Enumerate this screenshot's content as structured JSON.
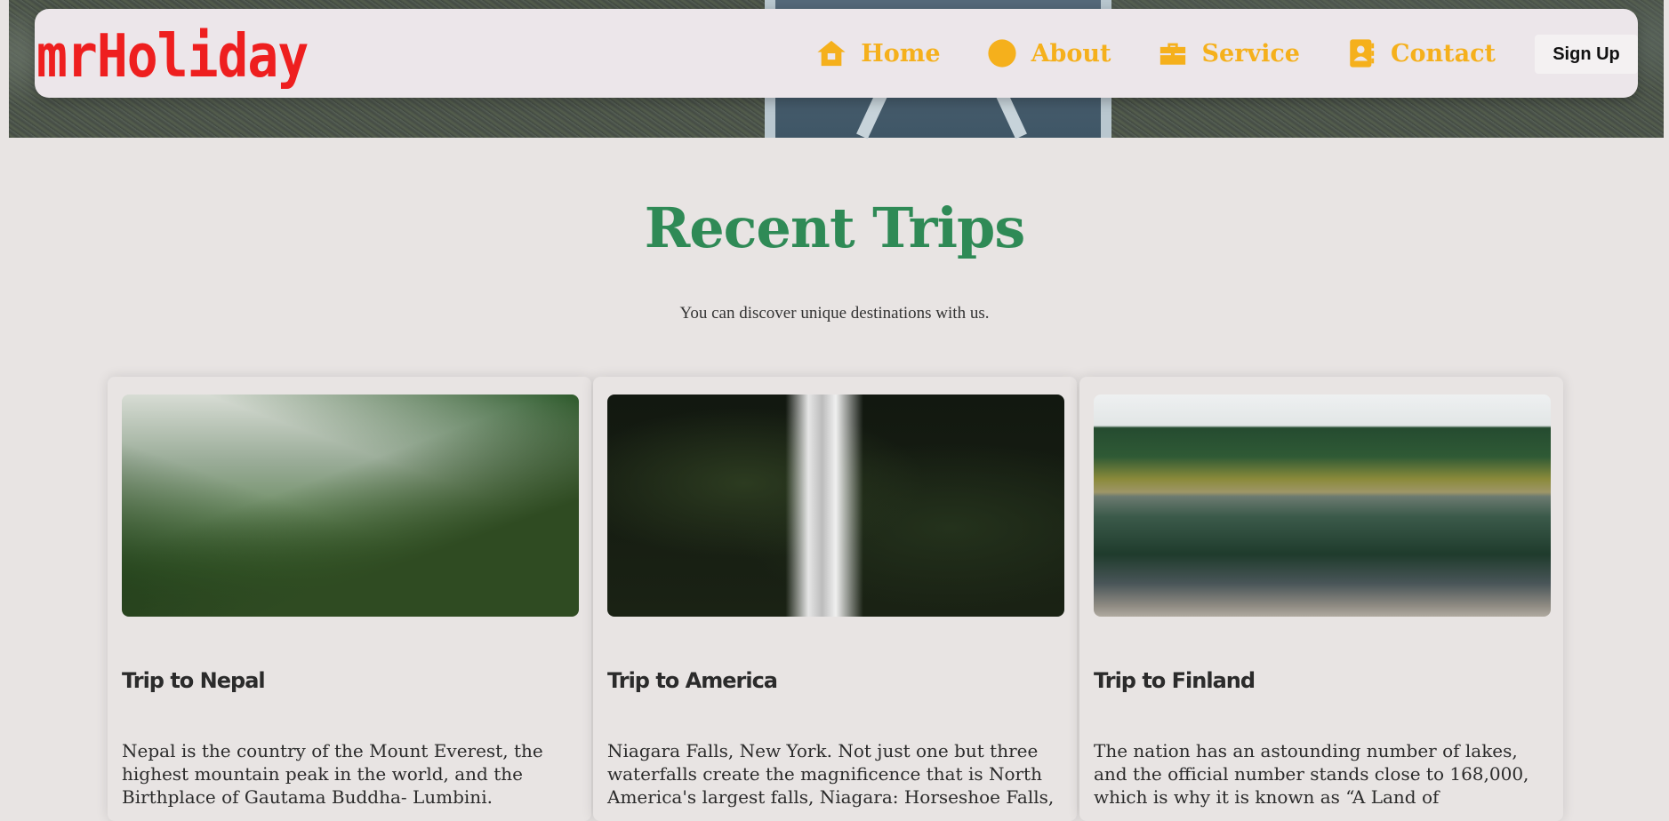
{
  "nav": {
    "logo": "mrHoliday",
    "links": [
      {
        "label": "Home",
        "icon": "house-icon"
      },
      {
        "label": "About",
        "icon": "circle-icon"
      },
      {
        "label": "Service",
        "icon": "briefcase-icon"
      },
      {
        "label": "Contact",
        "icon": "contact-book-icon"
      }
    ],
    "signup_label": "Sign Up"
  },
  "section": {
    "title": "Recent Trips",
    "subtitle": "You can discover unique destinations with us."
  },
  "trips": [
    {
      "title": "Trip to Nepal",
      "text": "Nepal is the country of the Mount Everest, the highest mountain peak in the world, and the Birthplace of Gautama Buddha- Lumbini."
    },
    {
      "title": "Trip to America",
      "text": "Niagara Falls, New York. Not just one but three waterfalls create the magnificence that is North America's largest falls, Niagara: Horseshoe Falls,"
    },
    {
      "title": "Trip to Finland",
      "text": "The nation has an astounding number of lakes, and the official number stands close to 168,000, which is why it is known as “A Land of"
    }
  ],
  "colors": {
    "logo": "#ee1f1f",
    "nav_link": "#f5b01c",
    "title": "#2f8a56",
    "page_bg": "#e8e4e3"
  }
}
